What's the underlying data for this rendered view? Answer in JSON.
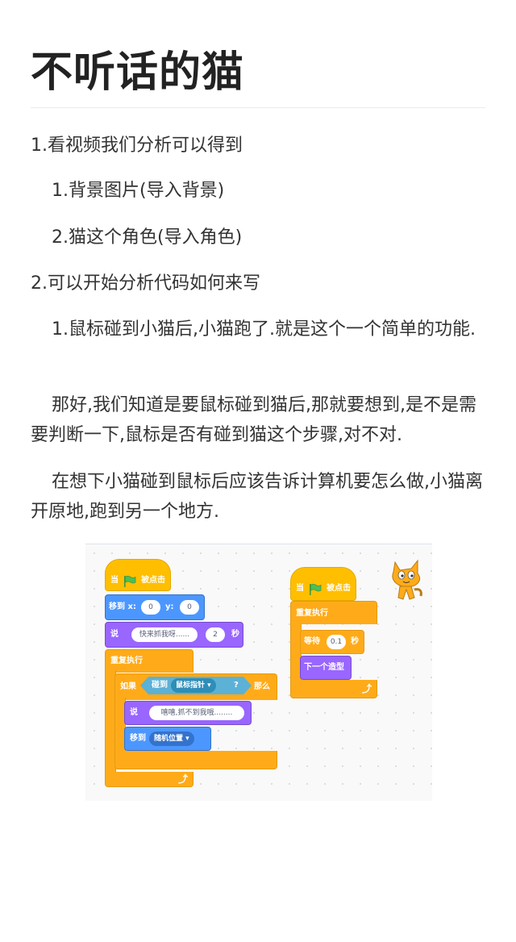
{
  "article": {
    "title": "不听话的猫",
    "paragraphs": [
      "1.看视频我们分析可以得到",
      "1.背景图片(导入背景)",
      "2.猫这个角色(导入角色)",
      "2.可以开始分析代码如何来写",
      "1.鼠标碰到小猫后,小猫跑了.就是这个一个简单的功能.",
      "那好,我们知道是要鼠标碰到猫后,那就要想到,是不是需要判断一下,鼠标是否有碰到猫这个步骤,对不对.",
      "在想下小猫碰到鼠标后应该告诉计算机要怎么做,小猫离开原地,跑到另一个地方."
    ]
  },
  "scratch": {
    "left_script": {
      "when_flag_clicked_pre": "当",
      "when_flag_clicked_post": "被点击",
      "goto_xy_label": "移到 x:",
      "goto_x": "0",
      "goto_y_label": "y:",
      "goto_y": "0",
      "say_label": "说",
      "say_text": "快来抓我呀......",
      "say_secs": "2",
      "secs_label": "秒",
      "forever_label": "重复执行",
      "if_label": "如果",
      "touching_label": "碰到",
      "touching_target": "鼠标指针",
      "question_mark": "?",
      "then_label": "那么",
      "say2_label": "说",
      "say2_text": "嘻嘻,抓不到我哦........",
      "goto_label": "移到",
      "goto_target": "随机位置"
    },
    "right_script": {
      "when_flag_clicked_pre": "当",
      "when_flag_clicked_post": "被点击",
      "forever_label": "重复执行",
      "wait_label": "等待",
      "wait_secs": "0.1",
      "secs_label": "秒",
      "next_costume_label": "下一个造型"
    },
    "colors": {
      "events": "#ffbf00",
      "control": "#ffab19",
      "motion": "#4c97ff",
      "looks": "#9966ff",
      "sensing": "#5cb1d6"
    }
  }
}
